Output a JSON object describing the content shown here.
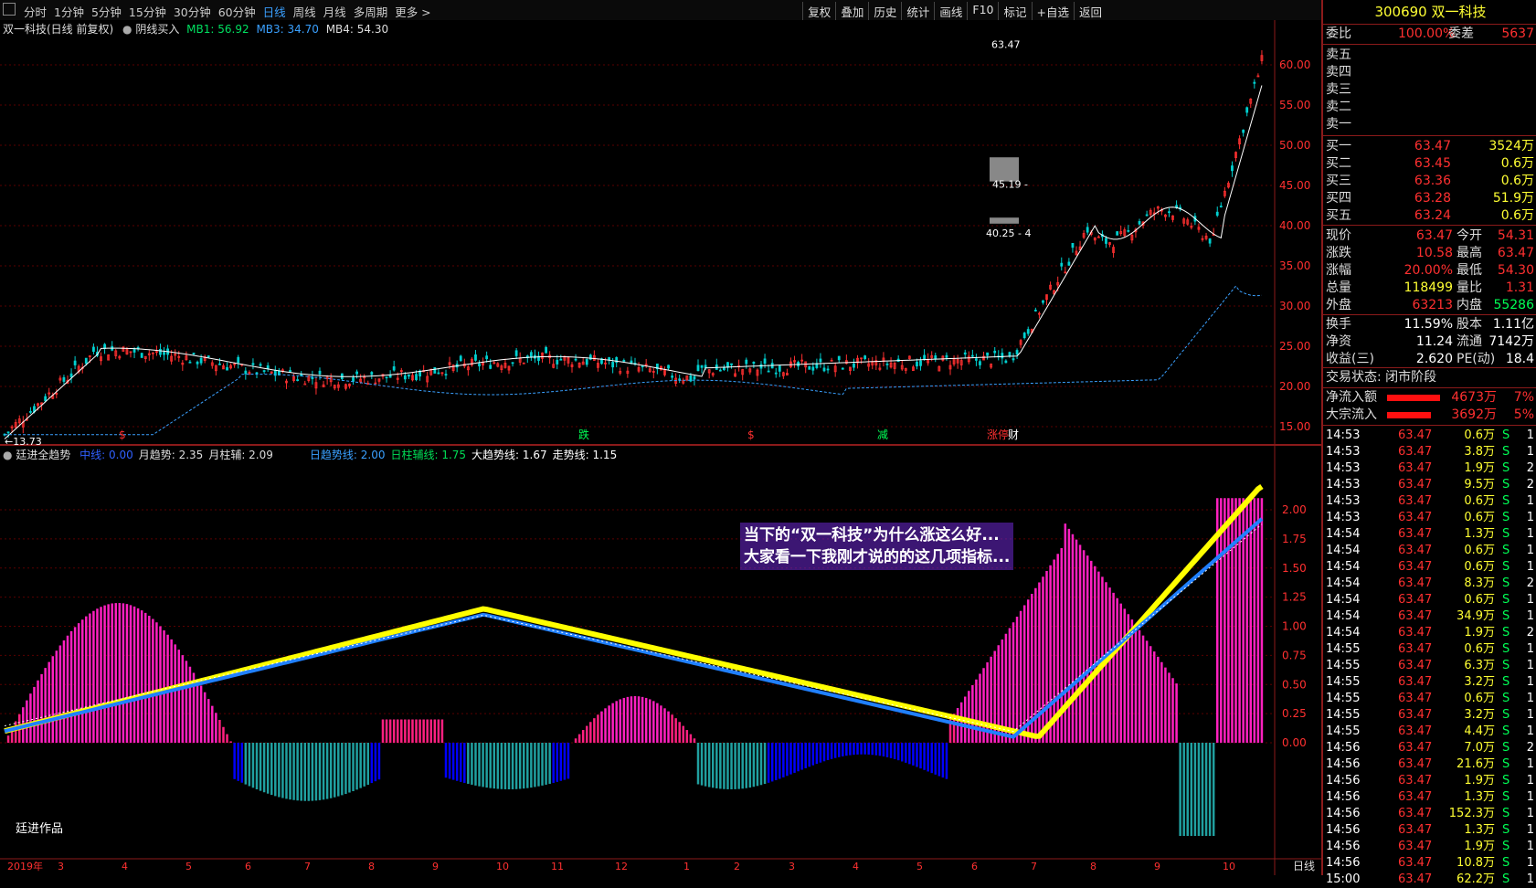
{
  "toolbar": {
    "periods": [
      "分时",
      "1分钟",
      "5分钟",
      "15分钟",
      "30分钟",
      "60分钟",
      "日线",
      "周线",
      "月线",
      "多周期",
      "更多 >"
    ],
    "active_period": "日线",
    "buttons": [
      "复权",
      "叠加",
      "历史",
      "统计",
      "画线",
      "F10",
      "标记",
      "+自选",
      "返回"
    ]
  },
  "main_chart": {
    "title": "双一科技(日线 前复权)",
    "indicator_name": "阴线买入",
    "mb1": "MB1: 56.92",
    "mb3": "MB3: 34.70",
    "mb4": "MB4: 54.30",
    "price_axis": [
      "60.00",
      "55.00",
      "50.00",
      "45.00",
      "40.00",
      "35.00",
      "30.00",
      "25.00",
      "20.00",
      "15.00"
    ],
    "high_label": "63.47",
    "low_label": "13.73",
    "box_label_1": "45.19 -",
    "box_label_2": "40.25 - 4",
    "markers": [
      "$",
      "跌",
      "$",
      "减",
      "涨停",
      "财"
    ]
  },
  "sub_chart": {
    "title": "廷进全趋势",
    "items": [
      {
        "text": "中线: 0.00",
        "color": "#3060ff"
      },
      {
        "text": "月趋势: 2.35",
        "color": "#ddd"
      },
      {
        "text": "月柱辅: 2.09",
        "color": "#ddd"
      },
      {
        "text": "日趋势线: 2.00",
        "color": "#3aa0ff"
      },
      {
        "text": "日柱辅线: 1.75",
        "color": "#00dd55"
      },
      {
        "text": "大趋势线: 1.67",
        "color": "#fff"
      },
      {
        "text": "走势线: 1.15",
        "color": "#fff"
      }
    ],
    "axis": [
      "2.00",
      "1.75",
      "1.50",
      "1.25",
      "1.00",
      "0.75",
      "0.50",
      "0.25",
      "0.00"
    ],
    "watermark": "廷进作品"
  },
  "time_axis": [
    "2019年",
    "3",
    "4",
    "5",
    "6",
    "7",
    "8",
    "9",
    "10",
    "11",
    "12",
    "1",
    "2",
    "3",
    "4",
    "5",
    "6",
    "7",
    "8",
    "9",
    "10"
  ],
  "bottom_right_label": "日线",
  "annotation": {
    "line1": "当下的“双一科技”为什么涨这么好...",
    "line2": "大家看一下我刚才说的的这几项指标..."
  },
  "quote": {
    "code": "300690",
    "name": "双一科技",
    "weibi_label": "委比",
    "weibi": "100.00%",
    "weicha_label": "委差",
    "weicha": "5637",
    "asks": [
      {
        "label": "卖五",
        "price": "",
        "vol": ""
      },
      {
        "label": "卖四",
        "price": "",
        "vol": ""
      },
      {
        "label": "卖三",
        "price": "",
        "vol": ""
      },
      {
        "label": "卖二",
        "price": "",
        "vol": ""
      },
      {
        "label": "卖一",
        "price": "",
        "vol": ""
      }
    ],
    "bids": [
      {
        "label": "买一",
        "price": "63.47",
        "vol": "3524万"
      },
      {
        "label": "买二",
        "price": "63.45",
        "vol": "0.6万"
      },
      {
        "label": "买三",
        "price": "63.36",
        "vol": "0.6万"
      },
      {
        "label": "买四",
        "price": "63.28",
        "vol": "51.9万"
      },
      {
        "label": "买五",
        "price": "63.24",
        "vol": "0.6万"
      }
    ],
    "stats": [
      {
        "l1": "现价",
        "v1": "63.47",
        "c1": "red",
        "l2": "今开",
        "v2": "54.31",
        "c2": "red"
      },
      {
        "l1": "涨跌",
        "v1": "10.58",
        "c1": "red",
        "l2": "最高",
        "v2": "63.47",
        "c2": "red"
      },
      {
        "l1": "涨幅",
        "v1": "20.00%",
        "c1": "red",
        "l2": "最低",
        "v2": "54.30",
        "c2": "red"
      },
      {
        "l1": "总量",
        "v1": "118499",
        "c1": "yel",
        "l2": "量比",
        "v2": "1.31",
        "c2": "red"
      },
      {
        "l1": "外盘",
        "v1": "63213",
        "c1": "red",
        "l2": "内盘",
        "v2": "55286",
        "c2": "grn"
      }
    ],
    "stats2": [
      {
        "l1": "换手",
        "v1": "11.59%",
        "l2": "股本",
        "v2": "1.11亿"
      },
      {
        "l1": "净资",
        "v1": "11.24",
        "l2": "流通",
        "v2": "7142万"
      },
      {
        "l1": "收益(三)",
        "v1": "2.620",
        "l2": "PE(动)",
        "v2": "18.4"
      }
    ],
    "trade_status": "交易状态: 闭市阶段",
    "flows": [
      {
        "label": "净流入额",
        "value": "4673万",
        "pct": "7%"
      },
      {
        "label": "大宗流入",
        "value": "3692万",
        "pct": "5%"
      }
    ],
    "ticks": [
      {
        "t": "14:53",
        "p": "63.47",
        "v": "0.6万",
        "s": "S",
        "n": "1"
      },
      {
        "t": "14:53",
        "p": "63.47",
        "v": "3.8万",
        "s": "S",
        "n": "1"
      },
      {
        "t": "14:53",
        "p": "63.47",
        "v": "1.9万",
        "s": "S",
        "n": "2"
      },
      {
        "t": "14:53",
        "p": "63.47",
        "v": "9.5万",
        "s": "S",
        "n": "2"
      },
      {
        "t": "14:53",
        "p": "63.47",
        "v": "0.6万",
        "s": "S",
        "n": "1"
      },
      {
        "t": "14:53",
        "p": "63.47",
        "v": "0.6万",
        "s": "S",
        "n": "1"
      },
      {
        "t": "14:54",
        "p": "63.47",
        "v": "1.3万",
        "s": "S",
        "n": "1"
      },
      {
        "t": "14:54",
        "p": "63.47",
        "v": "0.6万",
        "s": "S",
        "n": "1"
      },
      {
        "t": "14:54",
        "p": "63.47",
        "v": "0.6万",
        "s": "S",
        "n": "1"
      },
      {
        "t": "14:54",
        "p": "63.47",
        "v": "8.3万",
        "s": "S",
        "n": "2"
      },
      {
        "t": "14:54",
        "p": "63.47",
        "v": "0.6万",
        "s": "S",
        "n": "1"
      },
      {
        "t": "14:54",
        "p": "63.47",
        "v": "34.9万",
        "s": "S",
        "n": "1"
      },
      {
        "t": "14:54",
        "p": "63.47",
        "v": "1.9万",
        "s": "S",
        "n": "2"
      },
      {
        "t": "14:55",
        "p": "63.47",
        "v": "0.6万",
        "s": "S",
        "n": "1"
      },
      {
        "t": "14:55",
        "p": "63.47",
        "v": "6.3万",
        "s": "S",
        "n": "1"
      },
      {
        "t": "14:55",
        "p": "63.47",
        "v": "3.2万",
        "s": "S",
        "n": "1"
      },
      {
        "t": "14:55",
        "p": "63.47",
        "v": "0.6万",
        "s": "S",
        "n": "1"
      },
      {
        "t": "14:55",
        "p": "63.47",
        "v": "3.2万",
        "s": "S",
        "n": "1"
      },
      {
        "t": "14:55",
        "p": "63.47",
        "v": "4.4万",
        "s": "S",
        "n": "1"
      },
      {
        "t": "14:56",
        "p": "63.47",
        "v": "7.0万",
        "s": "S",
        "n": "2"
      },
      {
        "t": "14:56",
        "p": "63.47",
        "v": "21.6万",
        "s": "S",
        "n": "1"
      },
      {
        "t": "14:56",
        "p": "63.47",
        "v": "1.9万",
        "s": "S",
        "n": "1"
      },
      {
        "t": "14:56",
        "p": "63.47",
        "v": "1.3万",
        "s": "S",
        "n": "1"
      },
      {
        "t": "14:56",
        "p": "63.47",
        "v": "152.3万",
        "s": "S",
        "n": "1"
      },
      {
        "t": "14:56",
        "p": "63.47",
        "v": "1.3万",
        "s": "S",
        "n": "1"
      },
      {
        "t": "14:56",
        "p": "63.47",
        "v": "1.9万",
        "s": "S",
        "n": "1"
      },
      {
        "t": "14:56",
        "p": "63.47",
        "v": "10.8万",
        "s": "S",
        "n": "1"
      },
      {
        "t": "15:00",
        "p": "63.47",
        "v": "62.2万",
        "s": "S",
        "n": "1"
      }
    ]
  }
}
